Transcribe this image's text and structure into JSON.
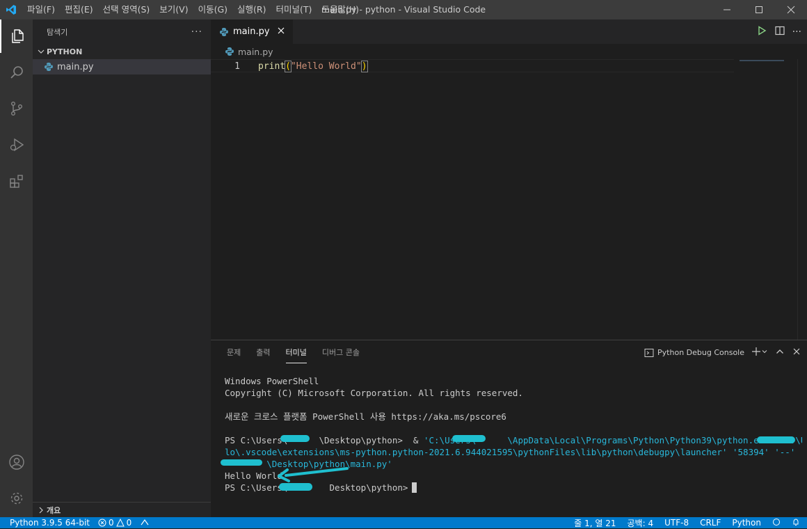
{
  "titlebar": {
    "menu": [
      "파일(F)",
      "편집(E)",
      "선택 영역(S)",
      "보기(V)",
      "이동(G)",
      "실행(R)",
      "터미널(T)",
      "도움말(H)"
    ],
    "window_title": "main.py - python - Visual Studio Code"
  },
  "sidebar": {
    "header": "탐색기",
    "more": "···",
    "folder": "PYTHON",
    "files": [
      "main.py"
    ],
    "outline": "개요"
  },
  "editor": {
    "tab_label": "main.py",
    "breadcrumb": "main.py",
    "line_number": "1",
    "code": {
      "fn": "print",
      "open": "(",
      "string": "\"Hello World\"",
      "close": ")"
    }
  },
  "panel": {
    "tabs": [
      "문제",
      "출력",
      "터미널",
      "디버그 콘솔"
    ],
    "active_tab": "터미널",
    "terminal_selector": "Python Debug Console",
    "terminal_lines": {
      "l1": "Windows PowerShell",
      "l2": "Copyright (C) Microsoft Corporation. All rights reserved.",
      "l3": "새로운 크로스 플랫폼 PowerShell 사용 https://aka.ms/pscore6",
      "l4_prompt": "PS C:\\Users\\      \\Desktop\\python>  & ",
      "l4_cmd": "'C:\\Users\\      \\AppData\\Local\\Programs\\Python\\Python39\\python.exe' 'c:\\Users\\    ",
      "l5": "lo\\.vscode\\extensions\\ms-python.python-2021.6.944021595\\pythonFiles\\lib\\python\\debugpy\\launcher' '58394' '--' 'c:\\Use",
      "l6": "        \\Desktop\\python\\main.py'",
      "l7": "Hello World",
      "l8": "PS C:\\Users\\        Desktop\\python>"
    }
  },
  "statusbar": {
    "interpreter": "Python 3.9.5 64-bit",
    "errors": "0",
    "warnings": "0",
    "position": "줄 1, 열 21",
    "spaces": "공백: 4",
    "encoding": "UTF-8",
    "eol": "CRLF",
    "language": "Python"
  },
  "colors": {
    "accent": "#007acc",
    "annotation": "#1fbfcf"
  }
}
